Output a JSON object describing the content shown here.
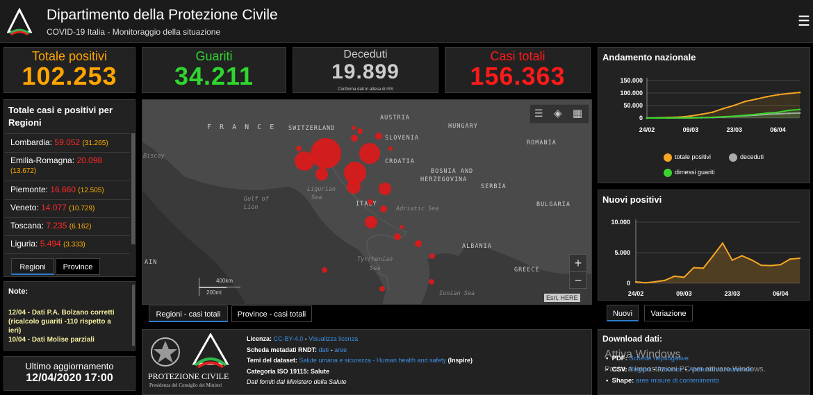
{
  "header": {
    "title": "Dipartimento della Protezione Civile",
    "subtitle": "COVID-19 Italia - Monitoraggio della situazione"
  },
  "kpis": {
    "positivi": {
      "label": "Totale positivi",
      "value": "102.253",
      "color": "#ffa500"
    },
    "guariti": {
      "label": "Guariti",
      "value": "34.211",
      "color": "#2fd62f"
    },
    "deceduti": {
      "label": "Deceduti",
      "value": "19.899",
      "note": "Conferma dati in attesa di ISS",
      "color": "#cccccc"
    },
    "casi": {
      "label": "Casi totali",
      "value": "156.363",
      "color": "#ff1a1a"
    }
  },
  "regions": {
    "title": "Totale casi e positivi per Regioni",
    "items": [
      {
        "name": "Lombardia:",
        "total": "59.052",
        "pos": "(31.265)"
      },
      {
        "name": "Emilia-Romagna:",
        "total": "20.098",
        "pos": "(13.672)"
      },
      {
        "name": "Piemonte:",
        "total": "16.660",
        "pos": "(12.505)"
      },
      {
        "name": "Veneto:",
        "total": "14.077",
        "pos": "(10.729)"
      },
      {
        "name": "Toscana:",
        "total": "7.235",
        "pos": "(6.162)"
      },
      {
        "name": "Liguria:",
        "total": "5.494",
        "pos": "(3.333)"
      }
    ],
    "tabs": [
      "Regioni",
      "Province"
    ]
  },
  "notes": {
    "title": "Note:",
    "items": [
      "12/04 - Dati P.A. Bolzano corretti (ricalcolo guariti -110 rispetto a ieri)",
      "10/04 - Dati  Molise parziali"
    ]
  },
  "update": {
    "label": "Ultimo aggiornamento",
    "value": "12/04/2020 17:00"
  },
  "map": {
    "labels": {
      "france": "F R A N C E",
      "switzerland": "SWITZERLAND",
      "austria": "AUSTRIA",
      "hungary": "HUNGARY",
      "slovenia": "SLOVENIA",
      "croatia": "CROATIA",
      "romania": "ROMANIA",
      "bosnia1": "BOSNIA AND",
      "bosnia2": "HERZEGOVINA",
      "serbia": "SERBIA",
      "italy": "ITALY",
      "bulgaria": "BULGARIA",
      "albania": "ALBANIA",
      "greece": "GREECE",
      "ain": "AIN"
    },
    "seas": {
      "biscay": "Biscay",
      "gulf1": "Gulf of",
      "gulf2": "Lion",
      "ligurian1": "Ligurian",
      "ligurian2": "Sea",
      "adriatic": "Adriatic Sea",
      "tyrrhenian1": "Tyrrhenian",
      "tyrrhenian2": "Sea",
      "ionian": "Ionian Sea"
    },
    "scale_km": "400km",
    "scale_mi": "200mi",
    "attribution": "Esri, HERE",
    "zoom_in": "+",
    "zoom_out": "−",
    "tabs": [
      "Regioni - casi totali",
      "Province - casi totali"
    ]
  },
  "trend": {
    "title": "Andamento nazionale",
    "yticks": [
      "150.000",
      "100.000",
      "50.000",
      "0"
    ],
    "xticks": [
      "24/02",
      "09/03",
      "23/03",
      "06/04"
    ],
    "legend": [
      "totale positivi",
      "deceduti",
      "dimessi guariti"
    ],
    "colors": {
      "positivi": "#f5a623",
      "deceduti": "#aaaaaa",
      "guariti": "#39d42f"
    }
  },
  "nuovi": {
    "title": "Nuovi positivi",
    "yticks": [
      "10.000",
      "5.000",
      "0"
    ],
    "xticks": [
      "24/02",
      "09/03",
      "23/03",
      "06/04"
    ],
    "tabs": [
      "Nuovi",
      "Variazione"
    ]
  },
  "chart_data": [
    {
      "type": "line",
      "title": "Andamento nazionale",
      "x": [
        "24/02",
        "28/02",
        "03/03",
        "06/03",
        "09/03",
        "13/03",
        "16/03",
        "20/03",
        "23/03",
        "27/03",
        "30/03",
        "03/04",
        "06/04",
        "10/04",
        "12/04"
      ],
      "series": [
        {
          "name": "totale positivi",
          "values": [
            221,
            885,
            2263,
            3916,
            7985,
            14955,
            23073,
            37860,
            50418,
            66414,
            75528,
            85388,
            93187,
            98273,
            102253
          ]
        },
        {
          "name": "deceduti",
          "values": [
            7,
            21,
            79,
            197,
            463,
            1266,
            2158,
            4032,
            6077,
            9134,
            11591,
            14681,
            16523,
            18849,
            19899
          ]
        },
        {
          "name": "dimessi guariti",
          "values": [
            1,
            46,
            160,
            523,
            724,
            1439,
            2749,
            5129,
            7432,
            10950,
            14620,
            19758,
            22837,
            30455,
            34211
          ]
        }
      ],
      "ylim": [
        0,
        150000
      ]
    },
    {
      "type": "area",
      "title": "Nuovi positivi",
      "x": [
        "24/02",
        "27/02",
        "01/03",
        "04/03",
        "07/03",
        "10/03",
        "13/03",
        "16/03",
        "19/03",
        "21/03",
        "23/03",
        "26/03",
        "29/03",
        "01/04",
        "04/04",
        "07/04",
        "10/04",
        "12/04"
      ],
      "values": [
        221,
        78,
        240,
        466,
        1145,
        977,
        2547,
        2470,
        4480,
        6557,
        3780,
        4492,
        3815,
        2937,
        2886,
        3039,
        3951,
        4092
      ],
      "ylim": [
        0,
        10000
      ]
    }
  ],
  "license": {
    "licenza_label": "Licenza:",
    "licenza_link": "CC-BY-4.0",
    "licenza_link2": "Visualizza licenza",
    "scheda_label": "Scheda metadati RNDT:",
    "scheda_link": "dati",
    "scheda_link2": "aree",
    "temi_label": "Temi del dataset:",
    "temi_link": "Salute umana e sicurezza - Human health and safety",
    "temi_suffix": "(Inspire)",
    "categoria": "Categoria ISO 19115: Salute",
    "fonte": "Dati forniti dal Ministero della Salute"
  },
  "pc": {
    "name": "PROTEZIONE CIVILE",
    "sub": "Presidenza del Consiglio dei Ministri"
  },
  "download": {
    "title": "Download dati:",
    "pdf_label": "PDF:",
    "pdf_link": "Schede riepilogative",
    "csv_label": "CSV:",
    "csv_link1": "Regioni",
    "csv_link2": "Province",
    "csv_link3": "Andamento nazionale",
    "shape_label": "Shape:",
    "shape_link": "aree misure di contenimento"
  },
  "watermark": {
    "line1": "Attiva Windows",
    "line2": "Passa a Impostazioni PC per attivare Windows."
  }
}
